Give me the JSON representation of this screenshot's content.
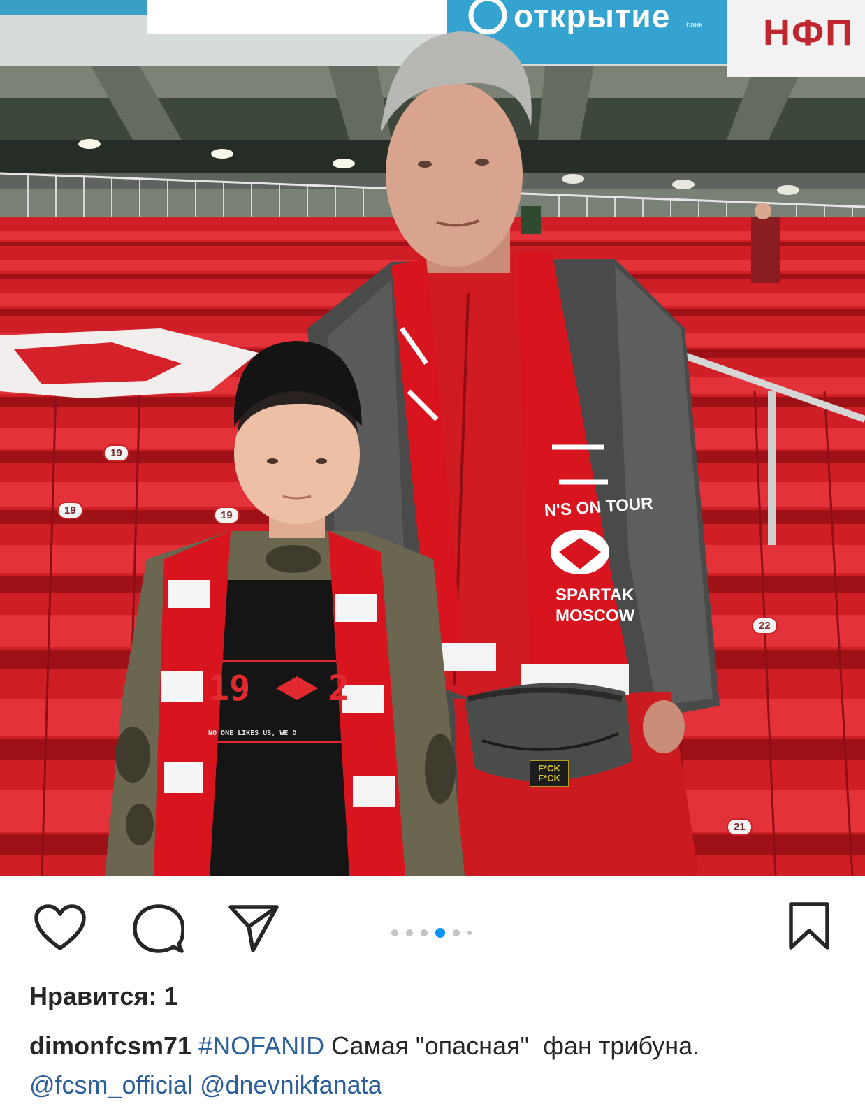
{
  "photo": {
    "banners": {
      "otkritie": "открытие",
      "otkritie_sub": "банк",
      "nfp": "НФП"
    },
    "seat_numbers": [
      "19",
      "19",
      "19",
      "22",
      "21"
    ],
    "shirt": {
      "year_left": "19",
      "year_right": "2",
      "slogan": "NO ONE LIKES US, WE D"
    },
    "scarf": {
      "line1": "N'S ON TOUR",
      "line2": "SPARTAK",
      "line3": "MOSCOW"
    },
    "bag_label": "F*CK F*CK"
  },
  "actions": {
    "like_icon": "heart-icon",
    "comment_icon": "comment-bubble-icon",
    "share_icon": "paper-plane-icon",
    "save_icon": "bookmark-icon",
    "carousel": {
      "count": 6,
      "active_index": 3
    }
  },
  "post": {
    "likes_text": "Нравится: 1",
    "username": "dimonfcsm71",
    "hashtag": "#NOFANID",
    "caption_text": " Самая \"опасная\"  фан трибуна.",
    "mention1": "@fcsm_official",
    "mention2": "@dnevnikfanata"
  },
  "colors": {
    "accent_blue": "#0095f6",
    "link_blue": "#2d5f9a",
    "spartak_red": "#d01c24",
    "text_dark": "#262626"
  }
}
